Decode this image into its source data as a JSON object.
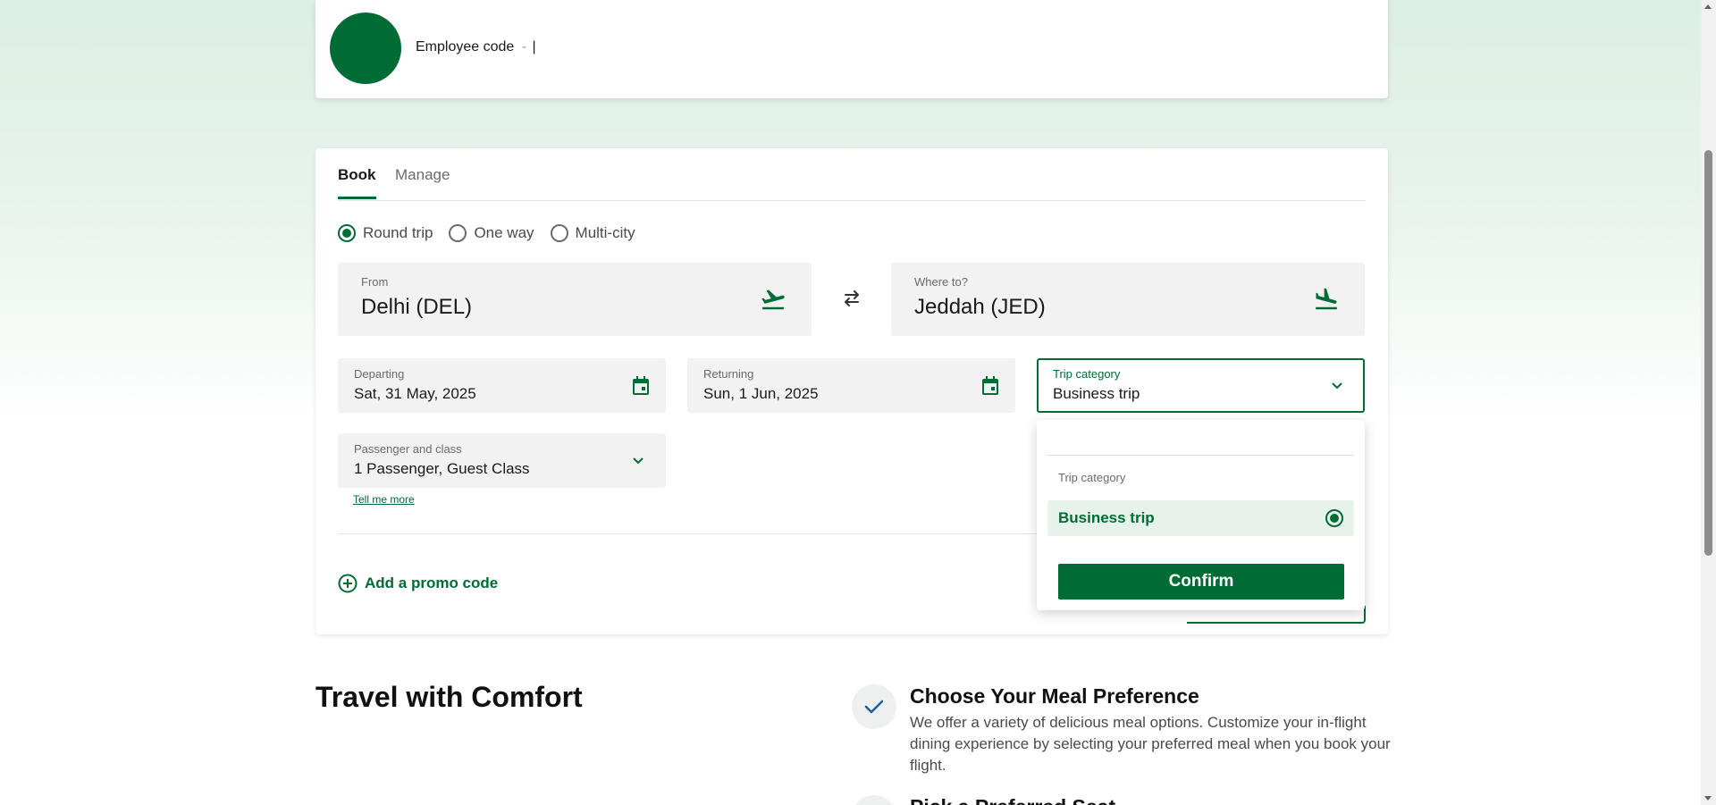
{
  "colors": {
    "brand": "#006c35",
    "brand_light": "#e6f2ea"
  },
  "employee": {
    "label": "Employee code",
    "separator": "-",
    "cursor": "|"
  },
  "tabs": [
    {
      "label": "Book",
      "active": true
    },
    {
      "label": "Manage",
      "active": false
    }
  ],
  "trip_types": [
    {
      "label": "Round trip",
      "selected": true
    },
    {
      "label": "One way",
      "selected": false
    },
    {
      "label": "Multi-city",
      "selected": false
    }
  ],
  "from": {
    "label": "From",
    "value": "Delhi (DEL)",
    "icon": "takeoff-icon"
  },
  "to": {
    "label": "Where to?",
    "value": "Jeddah (JED)",
    "icon": "landing-icon"
  },
  "departing": {
    "label": "Departing",
    "value": "Sat, 31 May, 2025",
    "icon": "calendar-icon"
  },
  "returning": {
    "label": "Returning",
    "value": "Sun, 1 Jun, 2025",
    "icon": "calendar-icon"
  },
  "trip_category": {
    "label": "Trip category",
    "value": "Business trip"
  },
  "passenger": {
    "label": "Passenger and class",
    "value": "1 Passenger, Guest Class",
    "tell_more": "Tell me more"
  },
  "promo": {
    "label": "Add a promo code"
  },
  "dropdown": {
    "title": "Trip category",
    "options": [
      {
        "label": "Business trip",
        "selected": true
      }
    ],
    "confirm": "Confirm"
  },
  "comfort": {
    "title": "Travel with Comfort",
    "features": [
      {
        "title": "Choose Your Meal Preference",
        "desc": "We offer a variety of delicious meal options. Customize your in-flight dining experience by selecting your preferred meal when you book your flight."
      },
      {
        "title": "Pick a Preferred Seat"
      }
    ]
  }
}
